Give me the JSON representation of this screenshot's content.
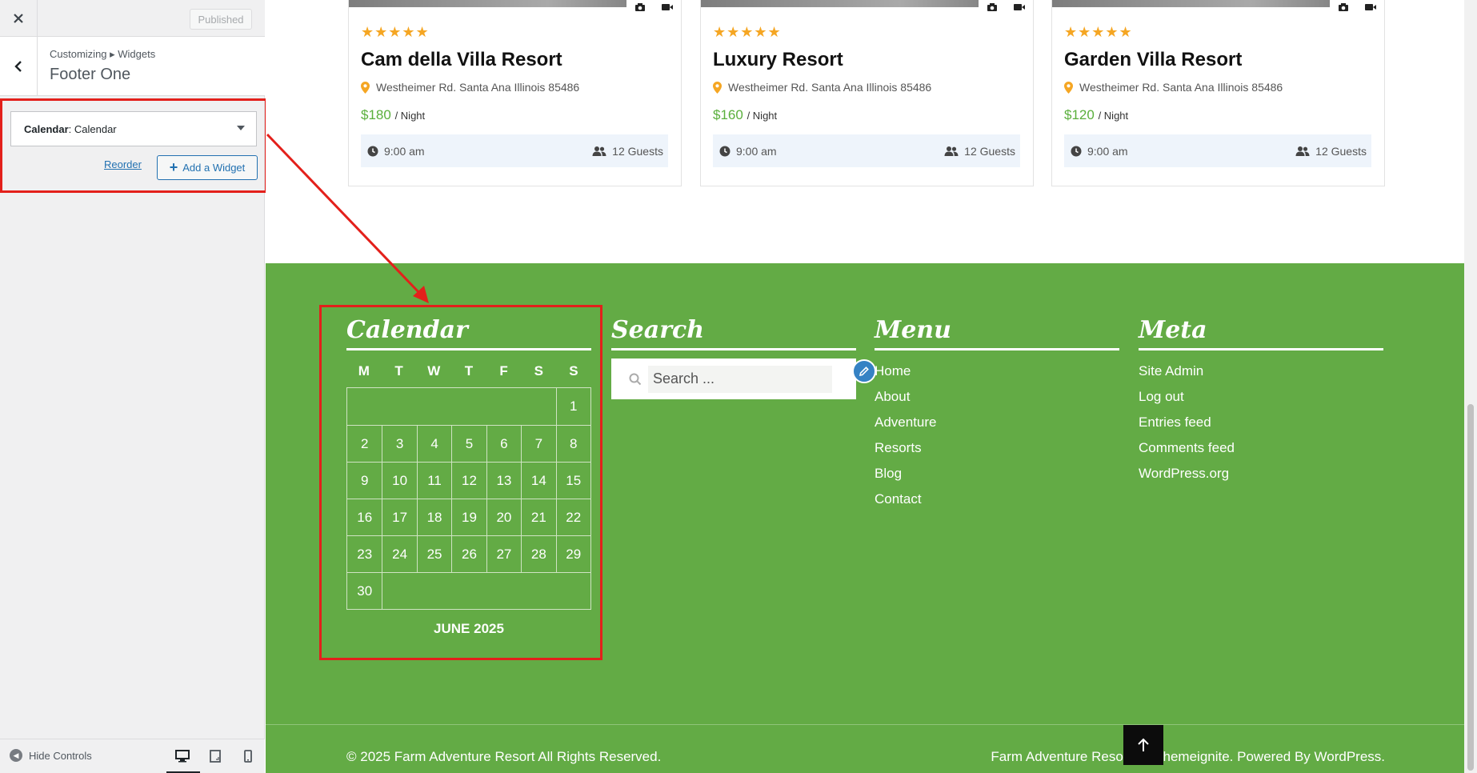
{
  "customizer": {
    "published_label": "Published",
    "breadcrumb": "Customizing ▸ Widgets",
    "section_title": "Footer One",
    "widget": {
      "type_label": "Calendar",
      "title": "Calendar"
    },
    "reorder_label": "Reorder",
    "add_widget_label": "Add a Widget",
    "hide_controls_label": "Hide Controls",
    "devices": [
      "desktop",
      "tablet",
      "mobile"
    ]
  },
  "cards": [
    {
      "stars": "★★★★★",
      "title": "Cam della Villa Resort",
      "address": "Westheimer Rd. Santa Ana Illinois 85486",
      "price": "$180",
      "unit": "/ Night",
      "time": "9:00 am",
      "guests": "12 Guests"
    },
    {
      "stars": "★★★★★",
      "title": "Luxury Resort",
      "address": "Westheimer Rd. Santa Ana Illinois 85486",
      "price": "$160",
      "unit": "/ Night",
      "time": "9:00 am",
      "guests": "12 Guests"
    },
    {
      "stars": "★★★★★",
      "title": "Garden Villa Resort",
      "address": "Westheimer Rd. Santa Ana Illinois 85486",
      "price": "$120",
      "unit": "/ Night",
      "time": "9:00 am",
      "guests": "12 Guests"
    }
  ],
  "footer": {
    "calendar": {
      "title": "Calendar",
      "weekdays": [
        "M",
        "T",
        "W",
        "T",
        "F",
        "S",
        "S"
      ],
      "days": [
        "1",
        "2",
        "3",
        "4",
        "5",
        "6",
        "7",
        "8",
        "9",
        "10",
        "11",
        "12",
        "13",
        "14",
        "15",
        "16",
        "17",
        "18",
        "19",
        "20",
        "21",
        "22",
        "23",
        "24",
        "25",
        "26",
        "27",
        "28",
        "29",
        "30"
      ],
      "caption": "JUNE 2025"
    },
    "search": {
      "title": "Search",
      "placeholder": "Search ..."
    },
    "menu": {
      "title": "Menu",
      "items": [
        "Home",
        "About",
        "Adventure",
        "Resorts",
        "Blog",
        "Contact"
      ]
    },
    "meta": {
      "title": "Meta",
      "items": [
        "Site Admin",
        "Log out",
        "Entries feed",
        "Comments feed",
        "WordPress.org"
      ]
    },
    "copyright": "© 2025 Farm Adventure Resort All Rights Reserved.",
    "credit": "Farm Adventure Resort By Themeignite. Powered By WordPress."
  },
  "colors": {
    "footer_green": "#63ab45",
    "annotation_red": "#e3201b",
    "price_green": "#5aaf3c",
    "star_orange": "#f5a623",
    "wp_blue": "#2271b1"
  }
}
